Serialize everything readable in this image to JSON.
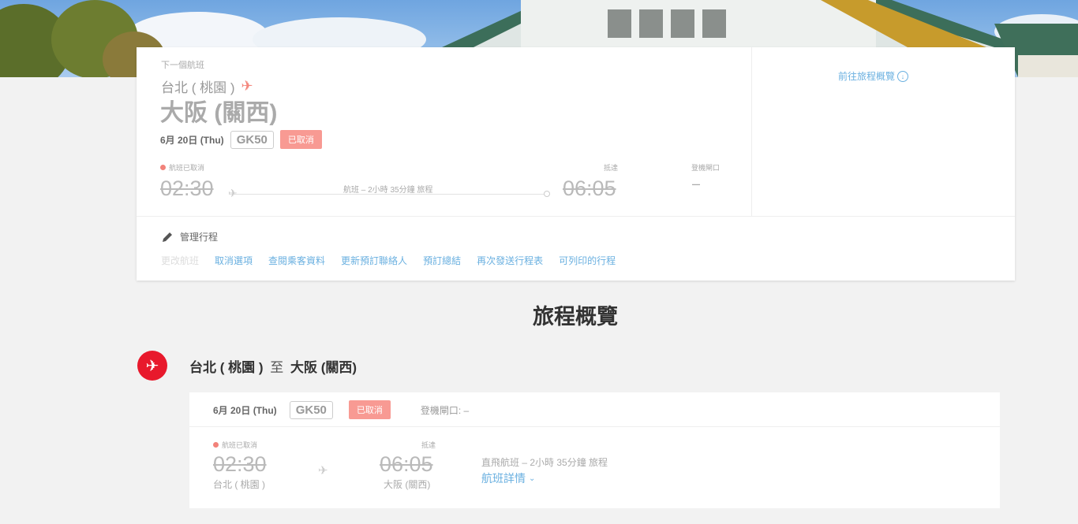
{
  "next_flight": {
    "label": "下一個航班",
    "origin": "台北 ( 桃園 )",
    "destination": "大阪 (關西)",
    "date": "6月 20日 (Thu)",
    "flight_number": "GK50",
    "status_badge": "已取消",
    "status_text": "航班已取消",
    "departure_time": "02:30",
    "route_text": "航班 – 2小時 35分鐘 旅程",
    "arrival_label": "抵達",
    "arrival_time": "06:05",
    "gate_label": "登機閘口",
    "gate_value": "–",
    "overview_link": "前往旅程概覽"
  },
  "manage": {
    "title": "管理行程",
    "actions": [
      "更改航班",
      "取消選項",
      "查閱乘客資料",
      "更新預訂聯絡人",
      "預訂總結",
      "再次發送行程表",
      "可列印的行程"
    ]
  },
  "itinerary": {
    "title": "旅程概覽",
    "segment": {
      "origin": "台北 ( 桃園 )",
      "to": "至",
      "destination": "大阪 (關西)",
      "date": "6月 20日 (Thu)",
      "flight_number": "GK50",
      "status_badge": "已取消",
      "gate": "登機閘口: –",
      "status_text": "航班已取消",
      "departure_time": "02:30",
      "departure_city": "台北 ( 桃園 )",
      "arrival_label": "抵達",
      "arrival_time": "06:05",
      "arrival_city": "大阪 (關西)",
      "duration": "直飛航班 – 2小時 35分鐘 旅程",
      "details_link": "航班詳情"
    }
  },
  "colors": {
    "accent": "#e8192c",
    "link": "#6ab0e0",
    "cancelled": "#f89a93"
  }
}
